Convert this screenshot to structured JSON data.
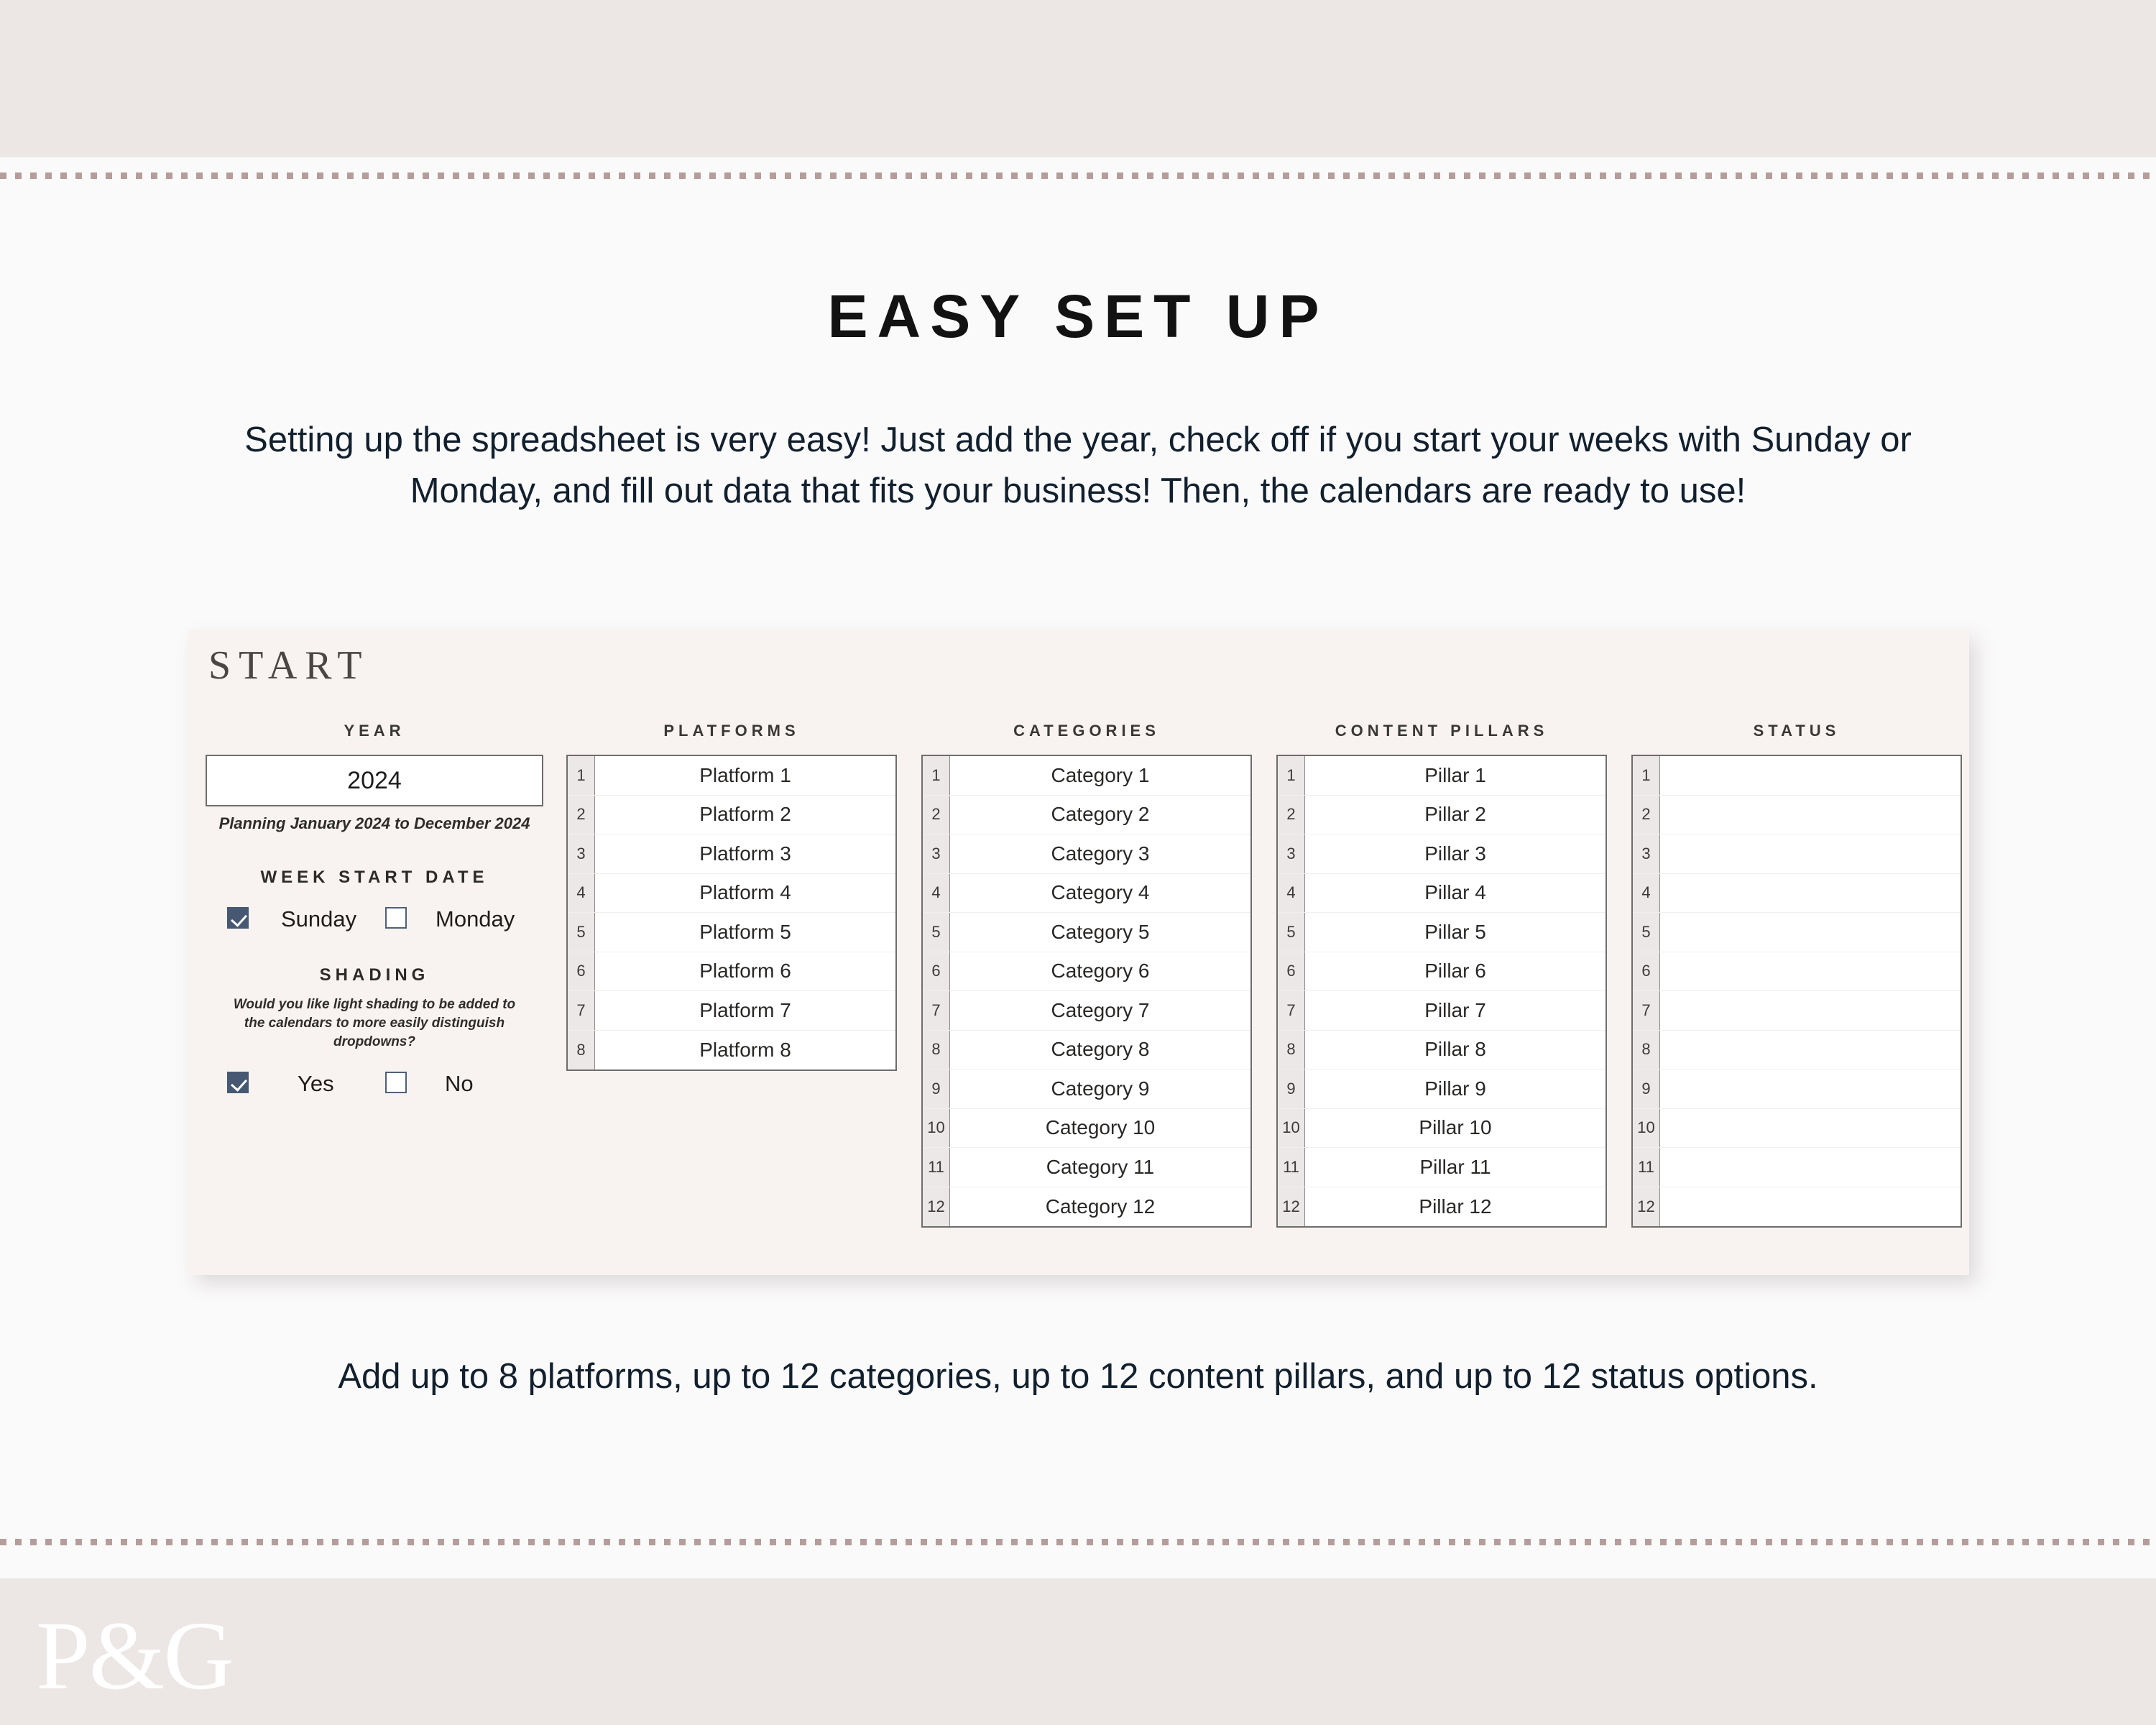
{
  "headline": "EASY SET UP",
  "intro": "Setting up the spreadsheet is very easy! Just add the year, check off if you start your weeks with Sunday or Monday, and fill out data that fits your business! Then, the calendars are ready to use!",
  "footer_note": "Add up to 8 platforms, up to 12 categories, up to 12 content pillars, and up to 12 status options.",
  "logo": "P&G",
  "panel": {
    "title": "START",
    "year_section": {
      "heading": "YEAR",
      "value": "2024",
      "subtext": "Planning January 2024 to December 2024"
    },
    "week_start": {
      "heading": "WEEK START DATE",
      "options": [
        {
          "label": "Sunday",
          "checked": true
        },
        {
          "label": "Monday",
          "checked": false
        }
      ]
    },
    "shading": {
      "heading": "SHADING",
      "note": "Would you like light shading to be added to the calendars to more easily distinguish dropdowns?",
      "options": [
        {
          "label": "Yes",
          "checked": true
        },
        {
          "label": "No",
          "checked": false
        }
      ]
    },
    "tables": [
      {
        "heading": "PLATFORMS",
        "rows": [
          {
            "num": "1",
            "value": "Platform 1"
          },
          {
            "num": "2",
            "value": "Platform 2"
          },
          {
            "num": "3",
            "value": "Platform 3"
          },
          {
            "num": "4",
            "value": "Platform 4"
          },
          {
            "num": "5",
            "value": "Platform 5"
          },
          {
            "num": "6",
            "value": "Platform 6"
          },
          {
            "num": "7",
            "value": "Platform 7"
          },
          {
            "num": "8",
            "value": "Platform 8"
          }
        ]
      },
      {
        "heading": "CATEGORIES",
        "rows": [
          {
            "num": "1",
            "value": "Category 1"
          },
          {
            "num": "2",
            "value": "Category 2"
          },
          {
            "num": "3",
            "value": "Category 3"
          },
          {
            "num": "4",
            "value": "Category 4"
          },
          {
            "num": "5",
            "value": "Category 5"
          },
          {
            "num": "6",
            "value": "Category 6"
          },
          {
            "num": "7",
            "value": "Category 7"
          },
          {
            "num": "8",
            "value": "Category 8"
          },
          {
            "num": "9",
            "value": "Category 9"
          },
          {
            "num": "10",
            "value": "Category 10"
          },
          {
            "num": "11",
            "value": "Category 11"
          },
          {
            "num": "12",
            "value": "Category 12"
          }
        ]
      },
      {
        "heading": "CONTENT PILLARS",
        "rows": [
          {
            "num": "1",
            "value": "Pillar 1"
          },
          {
            "num": "2",
            "value": "Pillar 2"
          },
          {
            "num": "3",
            "value": "Pillar 3"
          },
          {
            "num": "4",
            "value": "Pillar 4"
          },
          {
            "num": "5",
            "value": "Pillar 5"
          },
          {
            "num": "6",
            "value": "Pillar 6"
          },
          {
            "num": "7",
            "value": "Pillar 7"
          },
          {
            "num": "8",
            "value": "Pillar 8"
          },
          {
            "num": "9",
            "value": "Pillar 9"
          },
          {
            "num": "10",
            "value": "Pillar 10"
          },
          {
            "num": "11",
            "value": "Pillar 11"
          },
          {
            "num": "12",
            "value": "Pillar 12"
          }
        ]
      },
      {
        "heading": "STATUS",
        "rows": [
          {
            "num": "1",
            "value": ""
          },
          {
            "num": "2",
            "value": ""
          },
          {
            "num": "3",
            "value": ""
          },
          {
            "num": "4",
            "value": ""
          },
          {
            "num": "5",
            "value": ""
          },
          {
            "num": "6",
            "value": ""
          },
          {
            "num": "7",
            "value": ""
          },
          {
            "num": "8",
            "value": ""
          },
          {
            "num": "9",
            "value": ""
          },
          {
            "num": "10",
            "value": ""
          },
          {
            "num": "11",
            "value": ""
          },
          {
            "num": "12",
            "value": ""
          }
        ]
      }
    ]
  },
  "colors": {
    "band": "#ece6e5",
    "page_bg": "#fbfafa",
    "panel_bg": "#f8f3f1",
    "dot_rule": "#b49d9a",
    "checkbox_checked": "#465872",
    "text_dark": "#12202e"
  }
}
